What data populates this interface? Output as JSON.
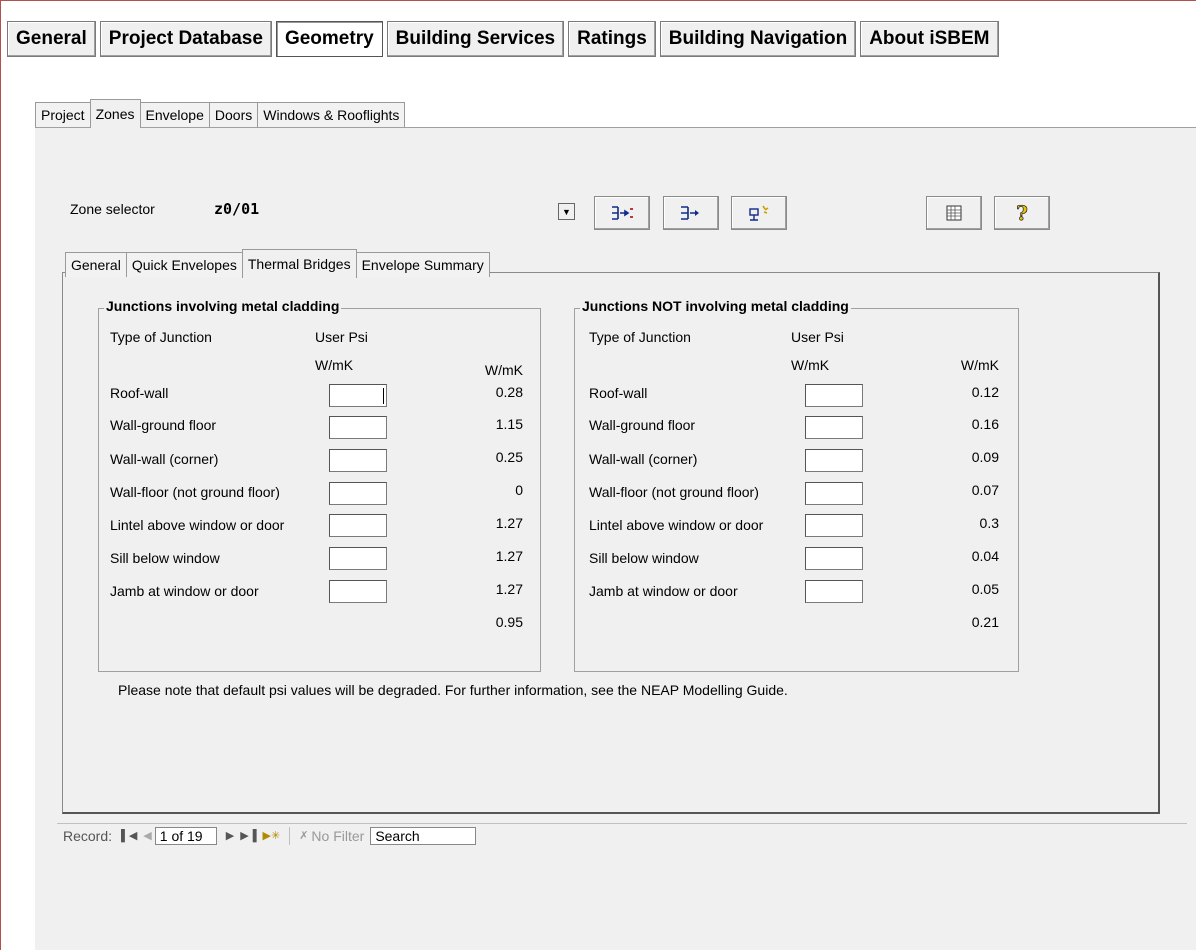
{
  "main_nav": [
    "General",
    "Project Database",
    "Geometry",
    "Building Services",
    "Ratings",
    "Building Navigation",
    "About iSBEM"
  ],
  "main_nav_active": "Geometry",
  "tabs": [
    "Project",
    "Zones",
    "Envelope",
    "Doors",
    "Windows & Rooflights"
  ],
  "tabs_active": "Zones",
  "zone_selector": {
    "label": "Zone selector",
    "value": "z0/01"
  },
  "sub_tabs": [
    "General",
    "Quick Envelopes",
    "Thermal Bridges",
    "Envelope Summary"
  ],
  "sub_tabs_active": "Thermal Bridges",
  "metal": {
    "title": "Junctions involving metal cladding",
    "col_type": "Type of Junction",
    "col_user": "User Psi",
    "unit_user": "W/mK",
    "unit_default": "W/mK",
    "rows": [
      {
        "label": "Roof-wall",
        "user_psi": "",
        "default": "0.28"
      },
      {
        "label": "Wall-ground floor",
        "user_psi": "",
        "default": "1.15"
      },
      {
        "label": "Wall-wall (corner)",
        "user_psi": "",
        "default": "0.25"
      },
      {
        "label": "Wall-floor (not ground floor)",
        "user_psi": "",
        "default": "0"
      },
      {
        "label": "Lintel above window or door",
        "user_psi": "",
        "default": "1.27"
      },
      {
        "label": "Sill below window",
        "user_psi": "",
        "default": "1.27"
      },
      {
        "label": "Jamb at window or door",
        "user_psi": "",
        "default": "1.27"
      }
    ],
    "total": "0.95"
  },
  "nonmetal": {
    "title": "Junctions NOT involving metal cladding",
    "col_type": "Type of Junction",
    "col_user": "User Psi",
    "unit_user": "W/mK",
    "unit_default": "W/mK",
    "rows": [
      {
        "label": "Roof-wall",
        "user_psi": "",
        "default": "0.12"
      },
      {
        "label": "Wall-ground floor",
        "user_psi": "",
        "default": "0.16"
      },
      {
        "label": "Wall-wall (corner)",
        "user_psi": "",
        "default": "0.09"
      },
      {
        "label": "Wall-floor (not ground floor)",
        "user_psi": "",
        "default": "0.07"
      },
      {
        "label": "Lintel above window or door",
        "user_psi": "",
        "default": "0.3"
      },
      {
        "label": "Sill below window",
        "user_psi": "",
        "default": "0.04"
      },
      {
        "label": "Jamb at window or door",
        "user_psi": "",
        "default": "0.05"
      }
    ],
    "total": "0.21"
  },
  "note": "Please note that default psi values will be degraded. For further information, see the NEAP Modelling Guide.",
  "record_nav": {
    "label": "Record:",
    "position": "1 of 19",
    "filter": "No Filter",
    "search_placeholder": "Search"
  }
}
